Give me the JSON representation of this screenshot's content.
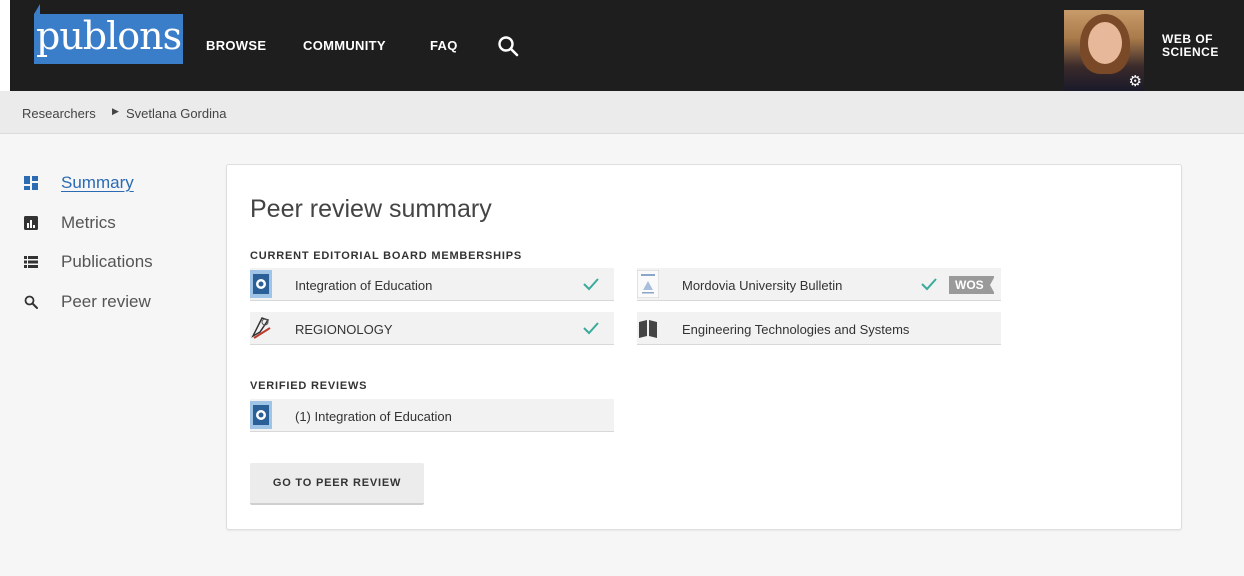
{
  "header": {
    "logo": "publons",
    "nav": [
      "BROWSE",
      "COMMUNITY",
      "FAQ"
    ],
    "wos_line1": "WEB OF",
    "wos_line2": "SCIENCE",
    "accent": "#3a7dc9",
    "icons": {
      "search": "search-icon",
      "settings": "gear-icon"
    }
  },
  "breadcrumb": {
    "root": "Researchers",
    "current": "Svetlana Gordina"
  },
  "sidebar": {
    "items": [
      {
        "label": "Summary",
        "icon": "dashboard-icon",
        "active": true
      },
      {
        "label": "Metrics",
        "icon": "bar-chart-icon",
        "active": false
      },
      {
        "label": "Publications",
        "icon": "list-icon",
        "active": false
      },
      {
        "label": "Peer review",
        "icon": "search-icon",
        "active": false
      }
    ],
    "active_color": "#2a6bb3"
  },
  "summary": {
    "title": "Peer review summary",
    "board_heading": "CURRENT EDITORIAL BOARD MEMBERSHIPS",
    "board": [
      {
        "name": "Integration of Education",
        "verified": true
      },
      {
        "name": "Mordovia University Bulletin",
        "verified": true,
        "badge": "WOS"
      },
      {
        "name": "REGIONOLOGY",
        "verified": true
      },
      {
        "name": "Engineering Technologies and Systems",
        "verified": false
      }
    ],
    "verified_heading": "VERIFIED REVIEWS",
    "verified": [
      {
        "name": "(1) Integration of Education"
      }
    ],
    "button": "GO TO PEER REVIEW",
    "check_color": "#3aaa9a"
  }
}
